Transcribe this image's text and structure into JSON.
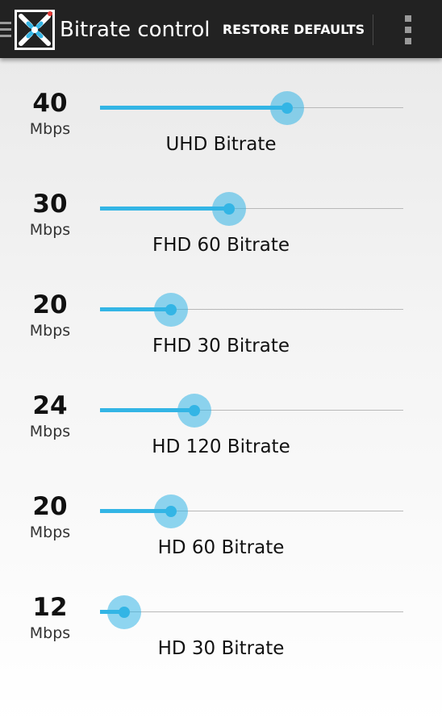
{
  "actionbar": {
    "title": "Bitrate control",
    "restore_label": "RESTORE DEFAULTS",
    "icons": {
      "nav": "hamburger-menu-icon",
      "app": "app-logo-icon",
      "overflow": "overflow-menu-icon"
    }
  },
  "colors": {
    "actionbar_bg": "#222222",
    "accent": "#33b5e5",
    "app_icon_dot": "#e53935"
  },
  "sliders": [
    {
      "value": "40",
      "unit": "Mbps",
      "label": "UHD Bitrate",
      "level": 0.6
    },
    {
      "value": "30",
      "unit": "Mbps",
      "label": "FHD 60 Bitrate",
      "level": 0.4
    },
    {
      "value": "20",
      "unit": "Mbps",
      "label": "FHD 30 Bitrate",
      "level": 0.2
    },
    {
      "value": "24",
      "unit": "Mbps",
      "label": "HD 120 Bitrate",
      "level": 0.28
    },
    {
      "value": "20",
      "unit": "Mbps",
      "label": "HD 60 Bitrate",
      "level": 0.2
    },
    {
      "value": "12",
      "unit": "Mbps",
      "label": "HD 30 Bitrate",
      "level": 0.04
    }
  ]
}
